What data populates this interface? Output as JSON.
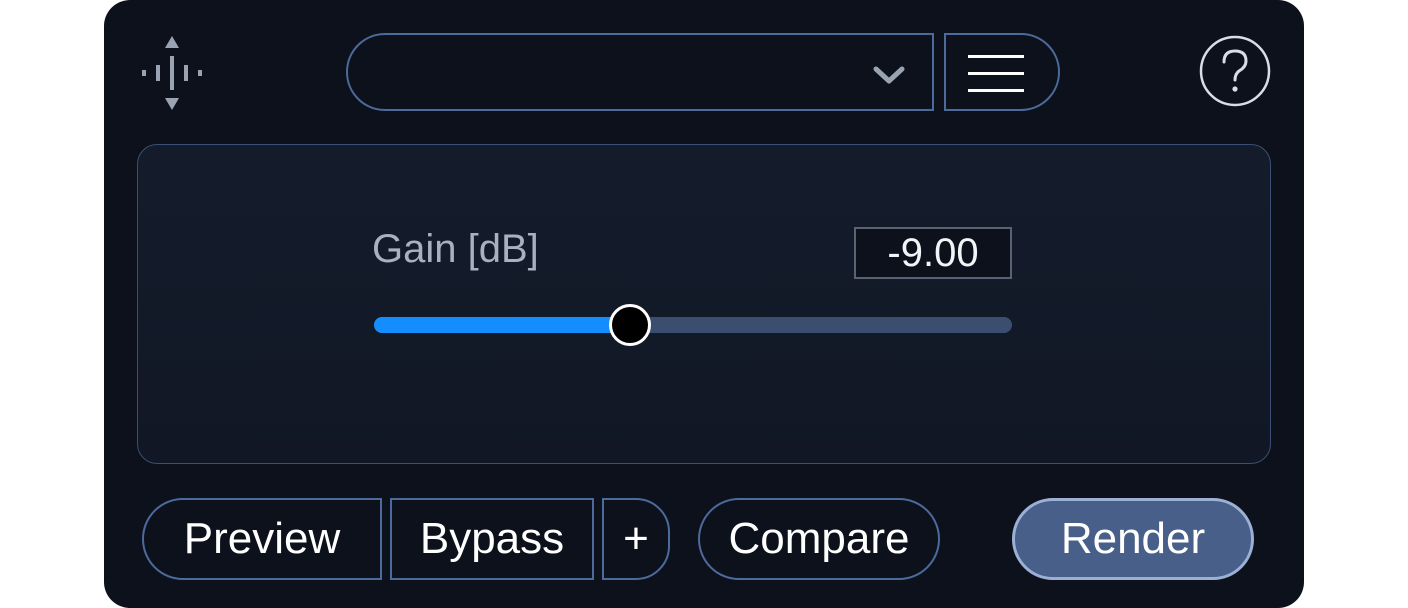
{
  "header": {
    "preset": {
      "value": ""
    },
    "icons": {
      "move": "move-handle-icon",
      "dropdown": "chevron-down-icon",
      "menu": "hamburger-menu-icon",
      "help": "help-icon"
    }
  },
  "parameter": {
    "label": "Gain [dB]",
    "value": "-9.00",
    "slider_fraction": 0.4
  },
  "footer": {
    "preview_label": "Preview",
    "bypass_label": "Bypass",
    "plus_label": "+",
    "compare_label": "Compare",
    "render_label": "Render"
  },
  "colors": {
    "background": "#0d111c",
    "accent": "#148dff",
    "border": "#4d6a9c",
    "render": "#475f89"
  }
}
